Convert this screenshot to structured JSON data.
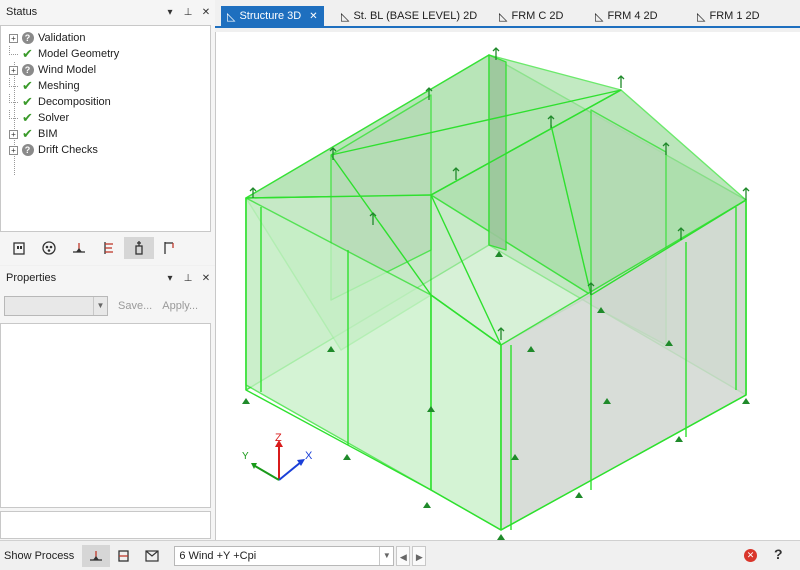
{
  "status_panel": {
    "title": "Status",
    "items": [
      {
        "label": "Validation",
        "state": "unknown",
        "expandable": true
      },
      {
        "label": "Model Geometry",
        "state": "done",
        "expandable": false
      },
      {
        "label": "Wind Model",
        "state": "unknown",
        "expandable": true
      },
      {
        "label": "Meshing",
        "state": "done",
        "expandable": false
      },
      {
        "label": "Decomposition",
        "state": "done",
        "expandable": false
      },
      {
        "label": "Solver",
        "state": "done",
        "expandable": false
      },
      {
        "label": "BIM",
        "state": "done",
        "expandable": true
      },
      {
        "label": "Drift Checks",
        "state": "unknown",
        "expandable": true
      }
    ],
    "header_buttons": [
      "dropdown-icon",
      "pin-icon",
      "close-icon"
    ]
  },
  "properties_panel": {
    "title": "Properties",
    "save_label": "Save...",
    "apply_label": "Apply...",
    "combo_value": ""
  },
  "tabs": [
    {
      "label": "Structure 3D",
      "active": true,
      "icon": "cube-icon"
    },
    {
      "label": "St. BL (BASE LEVEL) 2D",
      "active": false,
      "icon": "plan-icon"
    },
    {
      "label": "FRM C 2D",
      "active": false,
      "icon": "frame-icon"
    },
    {
      "label": "FRM 4 2D",
      "active": false,
      "icon": "frame-icon"
    },
    {
      "label": "FRM 1 2D",
      "active": false,
      "icon": "frame-icon"
    }
  ],
  "axes_labels": {
    "z": "Z",
    "y": "Y",
    "x": "X"
  },
  "bottom_bar": {
    "show_process_label": "Show Process",
    "load_case_value": "6 Wind +Y +Cpi"
  },
  "colors": {
    "accent_blue": "#1e6fbf",
    "model_green": "#2ee02e",
    "support_green": "#1f8a2a"
  }
}
